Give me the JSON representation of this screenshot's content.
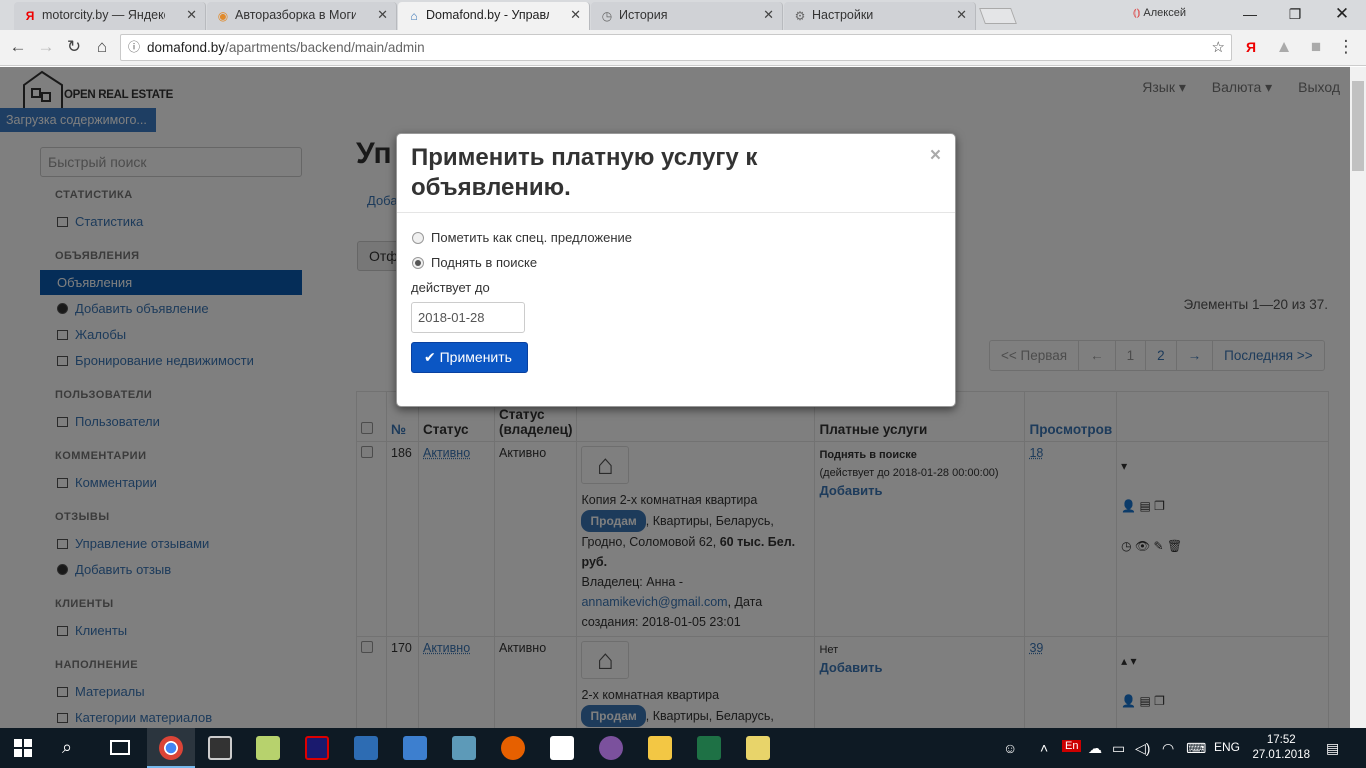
{
  "browser": {
    "tabs": [
      {
        "icon": "yandex-icon",
        "label": "motorcity.by — Яндекс"
      },
      {
        "icon": "web-icon",
        "label": "Авторазборка в Могилё"
      },
      {
        "icon": "home-icon",
        "label": "Domafond.by - Управле"
      },
      {
        "icon": "history-icon",
        "label": "История"
      },
      {
        "icon": "gear-icon",
        "label": "Настройки"
      }
    ],
    "user": "Алексей",
    "url_host": "domafond.by",
    "url_path": "/apartments/backend/main/admin"
  },
  "site": {
    "logo_text": "OPEN REAL ESTATE",
    "loading": "Загрузка содержимого...",
    "topnav": [
      "Язык ▾",
      "Валюта ▾",
      "Выход"
    ],
    "quick_search_placeholder": "Быстрый поиск"
  },
  "sidebar": {
    "sections": [
      {
        "heading": "СТАТИСТИКА",
        "items": [
          "Статистика"
        ]
      },
      {
        "heading": "ОБЪЯВЛЕНИЯ",
        "items": [
          "Объявления",
          "Добавить объявление",
          "Жалобы",
          "Бронирование недвижимости"
        ]
      },
      {
        "heading": "ПОЛЬЗОВАТЕЛИ",
        "items": [
          "Пользователи"
        ]
      },
      {
        "heading": "КОММЕНТАРИИ",
        "items": [
          "Комментарии"
        ]
      },
      {
        "heading": "ОТЗЫВЫ",
        "items": [
          "Управление отзывами",
          "Добавить отзыв"
        ]
      },
      {
        "heading": "КЛИЕНТЫ",
        "items": [
          "Клиенты"
        ]
      },
      {
        "heading": "НАПОЛНЕНИЕ",
        "items": [
          "Материалы",
          "Категории материалов"
        ]
      }
    ]
  },
  "main": {
    "title_partial": "Уп",
    "add_link_partial": "Доба",
    "filter_btn_partial": "Отф",
    "count": "Элементы 1—20 из 37.",
    "pager": [
      "<< Первая",
      "←",
      "1",
      "2",
      "→",
      "Последняя >>"
    ],
    "columns": [
      "№",
      "Статус",
      "Статус (владелец)",
      "",
      "Платные услуги",
      "Просмотров"
    ],
    "rows": [
      {
        "id": "186",
        "status": "Активно",
        "owner_status": "Активно",
        "title": "Копия 2-х комнатная квартира",
        "badge": "Продам",
        "desc1": ", Квартиры, Беларусь, Гродно, Соломовой 62,",
        "price": "60 тыс. Бел. руб.",
        "owner": "Владелец: Анна -",
        "email": "annamikevich@gmail.com",
        "created": ", Дата создания: 2018-01-05 23:01",
        "service": "Поднять в поиске",
        "service_until": "(действует до 2018-01-28 00:00:00)",
        "add": "Добавить",
        "views": "18"
      },
      {
        "id": "170",
        "status": "Активно",
        "owner_status": "Активно",
        "title": "2-х комнатная квартира",
        "badge": "Продам",
        "desc1": ", Квартиры, Беларусь, Гродно, Соломовой",
        "service": "Нет",
        "add": "Добавить",
        "views": "39"
      }
    ]
  },
  "modal": {
    "title": "Применить платную услугу к объявлению.",
    "close": "×",
    "options": [
      {
        "label": "Пометить как спец. предложение",
        "selected": false
      },
      {
        "label": "Поднять в поиске",
        "selected": true
      }
    ],
    "valid_label": "действует до",
    "date_value": "2018-01-28",
    "apply_label": "✔ Применить"
  },
  "taskbar": {
    "lang": "ENG",
    "time": "17:52",
    "date": "27.01.2018",
    "input_lang_badge": "En"
  },
  "colors": {
    "accent": "#3a76b6",
    "primary_button": "#0b56c4",
    "selected_nav": "#0a5bb0"
  }
}
